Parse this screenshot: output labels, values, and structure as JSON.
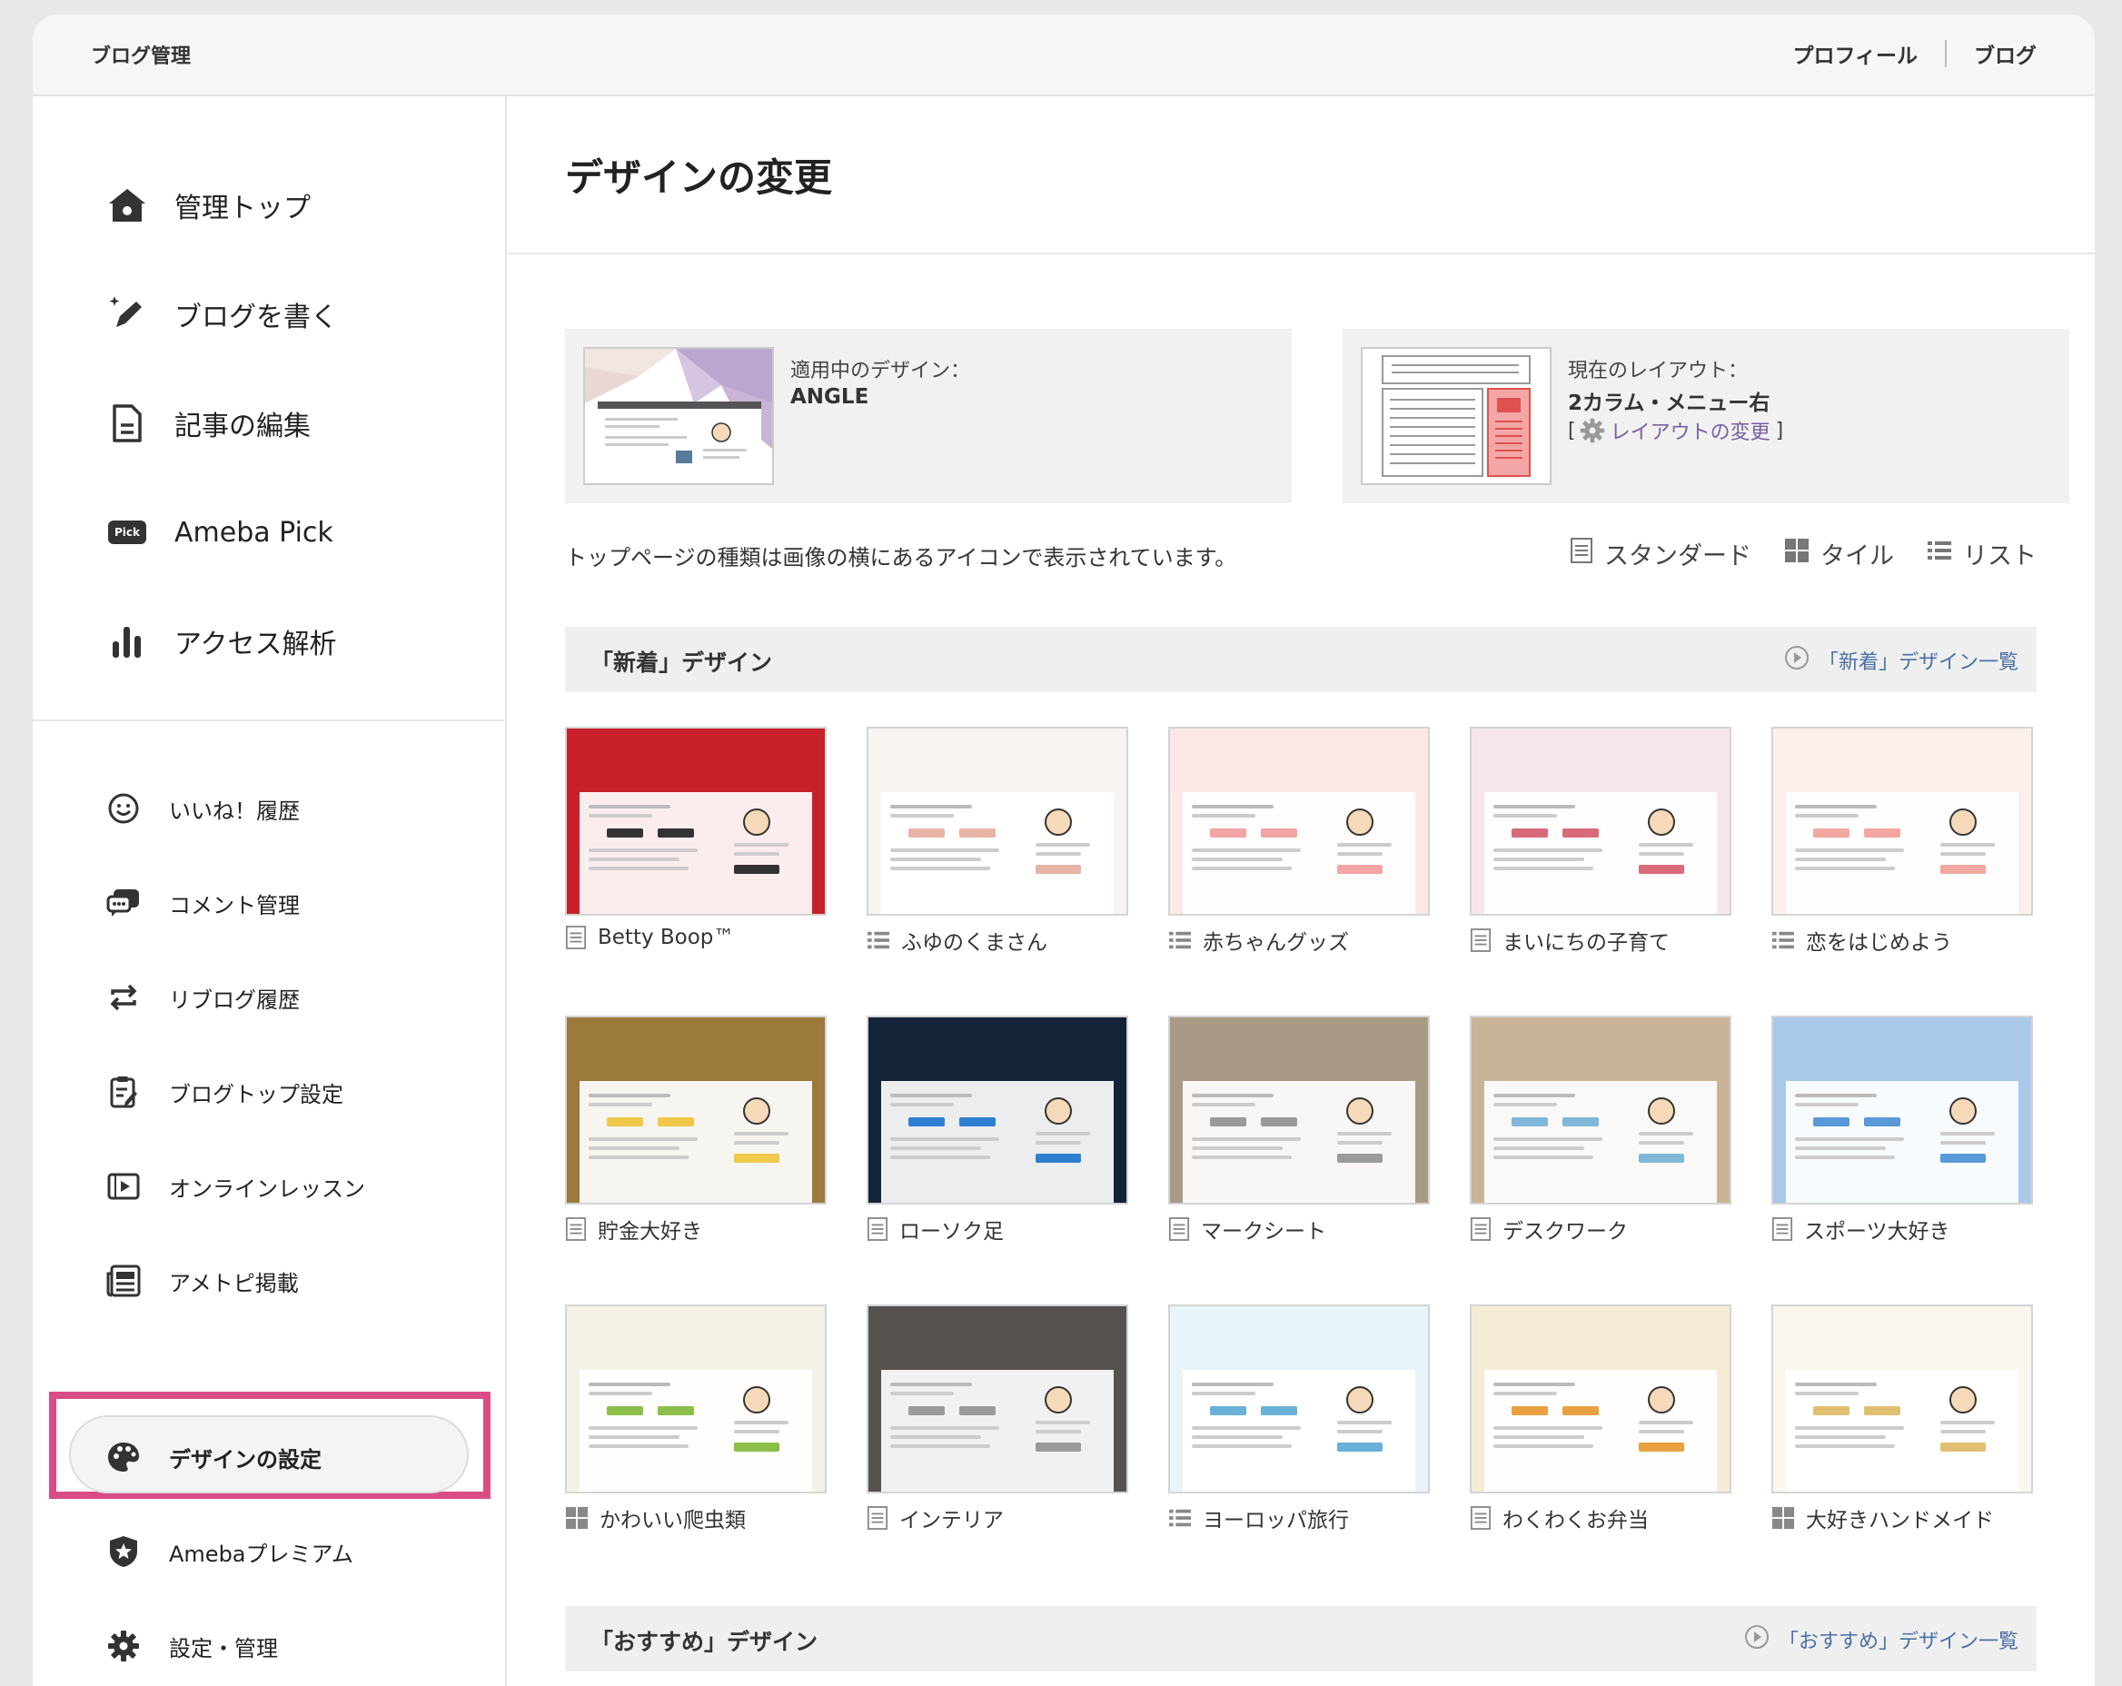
{
  "header": {
    "title": "ブログ管理",
    "links": [
      "プロフィール",
      "ブログ"
    ]
  },
  "sidebar": {
    "main_items": [
      {
        "label": "管理トップ",
        "icon": "home-icon"
      },
      {
        "label": "ブログを書く",
        "icon": "pen-sparkle-icon"
      },
      {
        "label": "記事の編集",
        "icon": "document-icon"
      },
      {
        "label": "Ameba Pick",
        "icon": "pick-badge-icon",
        "badge": "Pick"
      },
      {
        "label": "アクセス解析",
        "icon": "bar-chart-icon"
      }
    ],
    "sub_items": [
      {
        "label": "いいね！履歴",
        "icon": "smile-icon"
      },
      {
        "label": "コメント管理",
        "icon": "comment-icon"
      },
      {
        "label": "リブログ履歴",
        "icon": "reblog-icon"
      },
      {
        "label": "ブログトップ設定",
        "icon": "clipboard-edit-icon"
      },
      {
        "label": "オンラインレッスン",
        "icon": "video-lesson-icon"
      },
      {
        "label": "アメトピ掲載",
        "icon": "newspaper-icon"
      },
      {
        "label": "デザインの設定",
        "icon": "palette-icon",
        "active": true
      },
      {
        "label": "Amebaプレミアム",
        "icon": "star-shield-icon"
      },
      {
        "label": "設定・管理",
        "icon": "gear-icon"
      }
    ]
  },
  "main": {
    "title": "デザインの変更",
    "current_design": {
      "label": "適用中のデザイン：",
      "value": "ANGLE"
    },
    "current_layout": {
      "label": "現在のレイアウト：",
      "value": "2カラム・メニュー右",
      "bracket_open": "[",
      "bracket_close": "]",
      "change_link": "レイアウトの変更"
    },
    "notice": "トップページの種類は画像の横にあるアイコンで表示されています。",
    "view_options": [
      {
        "label": "スタンダード",
        "icon": "standard-icon"
      },
      {
        "label": "タイル",
        "icon": "tile-icon"
      },
      {
        "label": "リスト",
        "icon": "list-icon"
      }
    ],
    "sections": [
      {
        "title": "「新着」デザイン",
        "more": "「新着」デザイン一覧"
      },
      {
        "title": "「おすすめ」デザイン",
        "more": "「おすすめ」デザイン一覧"
      }
    ],
    "designs": [
      {
        "name": "Betty Boop™",
        "type": "standard",
        "bg": "#c8202a",
        "accent": "#333333"
      },
      {
        "name": "ふゆのくまさん",
        "type": "list",
        "bg": "#f7f4f2",
        "accent": "#e8b4a8"
      },
      {
        "name": "赤ちゃんグッズ",
        "type": "list",
        "bg": "#fbe8e4",
        "accent": "#f3a4a4"
      },
      {
        "name": "まいにちの子育て",
        "type": "standard",
        "bg": "#f6e6ea",
        "accent": "#d96a7a"
      },
      {
        "name": "恋をはじめよう",
        "type": "list",
        "bg": "#fbf1ea",
        "accent": "#f2a7a0"
      },
      {
        "name": "貯金大好き",
        "type": "standard",
        "bg": "#9c7a3c",
        "accent": "#f0c84a"
      },
      {
        "name": "ローソク足",
        "type": "standard",
        "bg": "#142438",
        "accent": "#2f7fd0"
      },
      {
        "name": "マークシート",
        "type": "standard",
        "bg": "#a99a86",
        "accent": "#9a9a9a"
      },
      {
        "name": "デスクワーク",
        "type": "standard",
        "bg": "#c9b49a",
        "accent": "#7fb8d8"
      },
      {
        "name": "スポーツ大好き",
        "type": "standard",
        "bg": "#a9c8ea",
        "accent": "#5a9ad8"
      },
      {
        "name": "かわいい爬虫類",
        "type": "tile",
        "bg": "#f4f1e6",
        "accent": "#8bbf4a"
      },
      {
        "name": "インテリア",
        "type": "standard",
        "bg": "#55524f",
        "accent": "#9a9a9a"
      },
      {
        "name": "ヨーロッパ旅行",
        "type": "list",
        "bg": "#e8f4f8",
        "accent": "#6ab0d8"
      },
      {
        "name": "わくわくお弁当",
        "type": "standard",
        "bg": "#f5ecd8",
        "accent": "#e8a040"
      },
      {
        "name": "大好きハンドメイド",
        "type": "tile",
        "bg": "#fbf7ee",
        "accent": "#e0c070"
      }
    ]
  }
}
